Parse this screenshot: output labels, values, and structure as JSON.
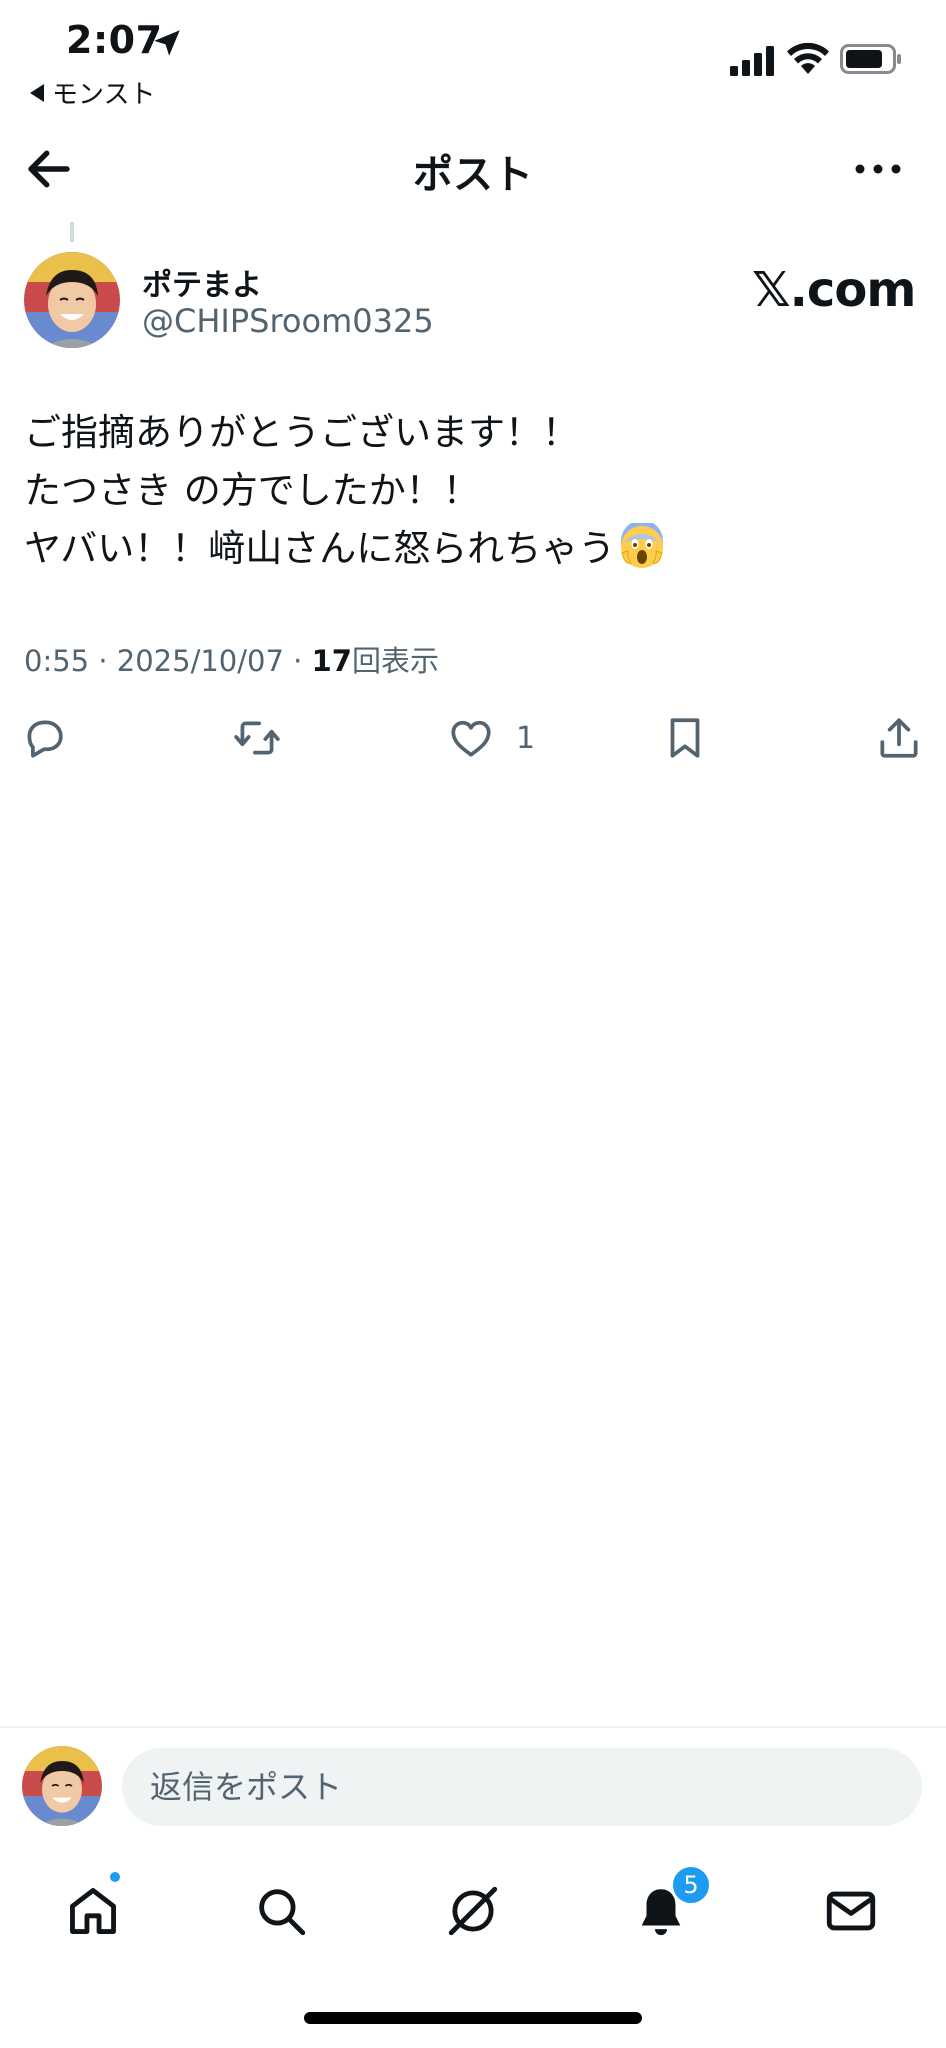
{
  "status_bar": {
    "time": "2:07",
    "back_app": "モンスト",
    "icons": [
      "location-arrow-icon",
      "cellular-signal-icon",
      "wifi-icon",
      "battery-icon"
    ]
  },
  "header": {
    "title": "ポスト",
    "icons": [
      "back-arrow-icon",
      "more-options-icon"
    ]
  },
  "post": {
    "author_name": "ポテまよ",
    "author_handle": "@CHIPSroom0325",
    "source_label": "𝕏.com",
    "text_lines": [
      "ご指摘ありがとうございます！！",
      "たつさき の方でしたか！！",
      "ヤバい！！﨑山さんに怒られちゃう"
    ],
    "emoji": "face-screaming-in-fear-emoji",
    "timestamp": "0:55 · 2025/10/07 · ",
    "views_count": "17",
    "views_label": "回表示",
    "like_count": "1"
  },
  "actions": [
    "reply-icon",
    "repost-icon",
    "like-icon",
    "bookmark-icon",
    "share-icon"
  ],
  "composer": {
    "placeholder": "返信をポスト"
  },
  "bottom_nav": {
    "items": [
      "home-icon",
      "search-icon",
      "grok-icon",
      "notifications-icon",
      "messages-icon"
    ],
    "notification_badge": "5"
  },
  "colors": {
    "text_primary": "#0f1419",
    "text_secondary": "#536471",
    "accent": "#1d9bf0",
    "input_bg": "#eff3f4"
  }
}
